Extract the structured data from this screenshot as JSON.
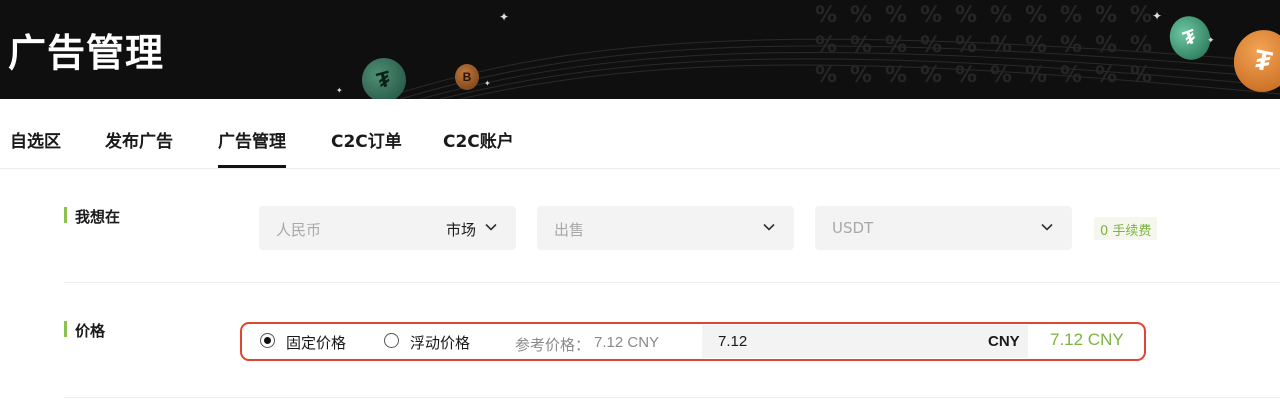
{
  "banner": {
    "title": "广告管理",
    "coin_green_small": "₮",
    "coin_orange_small": "B",
    "coin_green_large": "₮",
    "coin_orange_large": "₮"
  },
  "tabs": [
    {
      "label": "自选区",
      "active": false
    },
    {
      "label": "发布广告",
      "active": false
    },
    {
      "label": "广告管理",
      "active": true
    },
    {
      "label": "C2C订单",
      "active": false
    },
    {
      "label": "C2C账户",
      "active": false
    }
  ],
  "want": {
    "label": "我想在",
    "fiat_select": {
      "placeholder": "人民币",
      "value": "市场"
    },
    "side_select": {
      "placeholder": "出售"
    },
    "asset_select": {
      "placeholder": "USDT"
    },
    "fee_badge": "0 手续费"
  },
  "price": {
    "label": "价格",
    "fixed_label": "固定价格",
    "float_label": "浮动价格",
    "selected": "fixed",
    "reference_label": "参考价格：",
    "reference_value": "7.12 CNY",
    "input_value": "7.12",
    "unit": "CNY",
    "result": "7.12 CNY"
  },
  "colors": {
    "accent_green": "#8cc152",
    "highlight_red": "#e0452f",
    "banner_bg": "#0f0f0f"
  },
  "icons": [
    "chevron-down-icon",
    "radio-icon",
    "sparkle-icon",
    "coin-icon"
  ]
}
